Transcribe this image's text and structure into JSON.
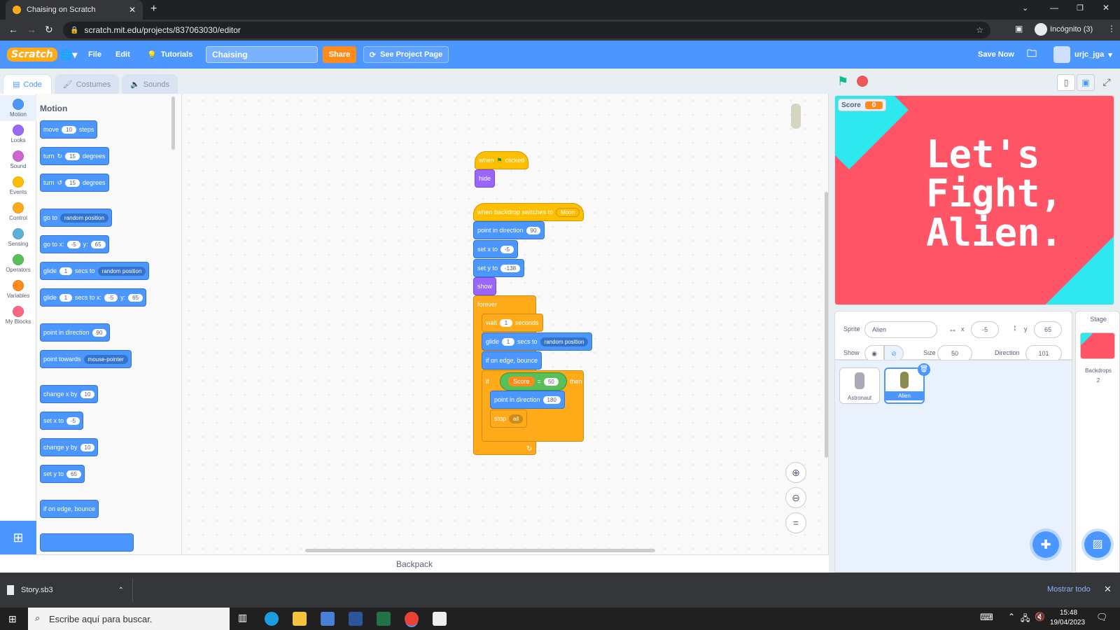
{
  "browser": {
    "tab_title": "Chaising on Scratch",
    "url": "scratch.mit.edu/projects/837063030/editor",
    "profile": "Incógnito (3)"
  },
  "menu": {
    "logo": "Scratch",
    "file": "File",
    "edit": "Edit",
    "tutorials": "Tutorials",
    "project_title": "Chaising",
    "share": "Share",
    "see_project": "See Project Page",
    "save_now": "Save Now",
    "user": "urjc_jga"
  },
  "editor_tabs": {
    "code": "Code",
    "costumes": "Costumes",
    "sounds": "Sounds"
  },
  "categories": [
    {
      "label": "Motion",
      "color": "#4c97ff"
    },
    {
      "label": "Looks",
      "color": "#9966ff"
    },
    {
      "label": "Sound",
      "color": "#cf63cf"
    },
    {
      "label": "Events",
      "color": "#ffbf00"
    },
    {
      "label": "Control",
      "color": "#ffab19"
    },
    {
      "label": "Sensing",
      "color": "#5cb1d6"
    },
    {
      "label": "Operators",
      "color": "#59c059"
    },
    {
      "label": "Variables",
      "color": "#ff8c1a"
    },
    {
      "label": "My Blocks",
      "color": "#ff6680"
    }
  ],
  "palette": {
    "heading": "Motion",
    "move": "move",
    "move_val": "10",
    "steps": "steps",
    "turn": "turn",
    "turn_val": "15",
    "degrees": "degrees",
    "go_to": "go to",
    "random_position": "random position",
    "go_to_xy": "go to x:",
    "x_val": "-5",
    "y_lbl": "y:",
    "y_val": "65",
    "glide": "glide",
    "glide_val": "1",
    "secs_to": "secs to",
    "secs_to_x": "secs to x:",
    "point_in_direction": "point in direction",
    "dir_val": "90",
    "point_towards": "point towards",
    "mouse_pointer": "mouse-pointer",
    "change_x_by": "change x by",
    "change_val": "10",
    "set_x_to": "set x to",
    "change_y_by": "change y by",
    "set_y_to": "set y to",
    "if_on_edge": "if on edge, bounce"
  },
  "script": {
    "when": "when",
    "clicked": "clicked",
    "hide": "hide",
    "when_backdrop": "when backdrop switches to",
    "backdrop": "Moon",
    "point_in_direction": "point in direction",
    "dir1": "90",
    "set_x_to": "set x to",
    "x": "-5",
    "set_y_to": "set y to",
    "y": "-138",
    "show": "show",
    "forever": "forever",
    "wait": "wait",
    "wait_val": "1",
    "seconds": "seconds",
    "glide": "glide",
    "glide_val": "1",
    "secs_to": "secs to",
    "random_position": "random position",
    "if_on_edge": "if on edge, bounce",
    "if": "if",
    "score": "Score",
    "eq": "=",
    "score_val": "50",
    "then": "then",
    "point_dir2": "point in direction",
    "dir2": "180",
    "stop": "stop",
    "stop_val": "all"
  },
  "backpack": "Backpack",
  "stage": {
    "score_label": "Score",
    "score_value": "0",
    "line1": "Let's",
    "line2": "Fight,",
    "line3": "Alien."
  },
  "sprite_info": {
    "sprite_label": "Sprite",
    "sprite_name": "Alien",
    "x_label": "x",
    "x": "-5",
    "y_label": "y",
    "y": "65",
    "show_label": "Show",
    "size_label": "Size",
    "size": "50",
    "direction_label": "Direction",
    "direction": "101"
  },
  "sprites": [
    {
      "name": "Astronaut"
    },
    {
      "name": "Alien"
    }
  ],
  "stage_pane": {
    "title": "Stage",
    "backdrops_label": "Backdrops",
    "backdrops_count": "2"
  },
  "downloads": {
    "file": "Story.sb3",
    "show_all": "Mostrar todo"
  },
  "taskbar": {
    "search": "Escribe aquí para buscar.",
    "time": "15:48",
    "date": "19/04/2023"
  }
}
